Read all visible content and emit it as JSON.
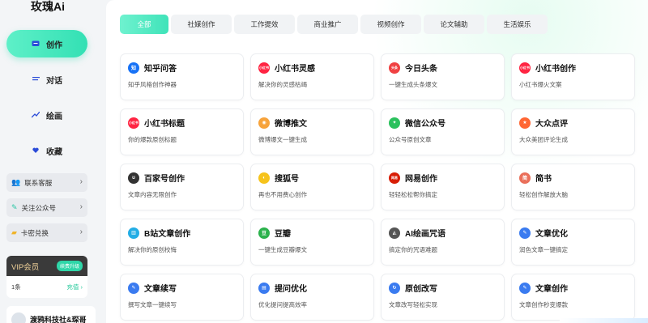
{
  "app": {
    "title": "玫瑰Ai"
  },
  "nav": [
    {
      "label": "创作",
      "icon": "chat-icon",
      "active": true
    },
    {
      "label": "对话",
      "icon": "chat-lines-icon",
      "active": false
    },
    {
      "label": "绘画",
      "icon": "brush-icon",
      "active": false
    },
    {
      "label": "收藏",
      "icon": "heart-icon",
      "active": false
    }
  ],
  "side_links": [
    {
      "label": "联系客服",
      "icon": "support-icon"
    },
    {
      "label": "关注公众号",
      "icon": "pin-icon"
    },
    {
      "label": "卡密兑换",
      "icon": "ticket-icon"
    }
  ],
  "vip": {
    "title": "VIP会员",
    "button": "续费升级",
    "count": "1条",
    "recharge": "充值 ›"
  },
  "company": {
    "name": "渡鸦科技社&琛哥"
  },
  "tabs": [
    "全部",
    "社媒创作",
    "工作提效",
    "商业推广",
    "视频创作",
    "论文辅助",
    "生活娱乐"
  ],
  "colors": {
    "accent": "#3fe3b9",
    "vip_gold": "#f2d39a"
  },
  "cards": [
    {
      "title": "知乎问答",
      "desc": "知乎风格创作神器",
      "icon": "zhihu-icon",
      "color": "#1772f6",
      "glyph": "知"
    },
    {
      "title": "小红书灵感",
      "desc": "解决你的灵感枯竭",
      "icon": "xiaohongshu-icon",
      "color": "#ff2442",
      "glyph": "小红书"
    },
    {
      "title": "今日头条",
      "desc": "一键生成头条爆文",
      "icon": "toutiao-icon",
      "color": "#f04142",
      "glyph": "头条"
    },
    {
      "title": "小红书创作",
      "desc": "小红书爆火文案",
      "icon": "xiaohongshu-icon",
      "color": "#ff2442",
      "glyph": "小红书"
    },
    {
      "title": "小红书标题",
      "desc": "你的爆款原创标题",
      "icon": "xiaohongshu-icon",
      "color": "#ff2442",
      "glyph": "小红书"
    },
    {
      "title": "微博推文",
      "desc": "微博爆文一键生成",
      "icon": "weibo-icon",
      "color": "#f7a33b",
      "glyph": "◉"
    },
    {
      "title": "微信公众号",
      "desc": "公众号原创文章",
      "icon": "wechat-icon",
      "color": "#2bc15d",
      "glyph": "✦"
    },
    {
      "title": "大众点评",
      "desc": "大众美团评论生成",
      "icon": "dianping-icon",
      "color": "#ff6633",
      "glyph": "★"
    },
    {
      "title": "百家号创作",
      "desc": "文章内容无限创作",
      "icon": "baijiahao-icon",
      "color": "#333333",
      "glyph": "ʊ"
    },
    {
      "title": "搜狐号",
      "desc": "再也不用费心创作",
      "icon": "sohu-icon",
      "color": "#f6c31c",
      "glyph": "◐"
    },
    {
      "title": "网易创作",
      "desc": "轻轻松松帮你搞定",
      "icon": "netease-icon",
      "color": "#d81e06",
      "glyph": "网易"
    },
    {
      "title": "简书",
      "desc": "轻松创作解放大脑",
      "icon": "jianshu-icon",
      "color": "#ea6f5a",
      "glyph": "简"
    },
    {
      "title": "B站文章创作",
      "desc": "解决你的原创校悔",
      "icon": "bilibili-icon",
      "color": "#23ade5",
      "glyph": "▥"
    },
    {
      "title": "豆瓣",
      "desc": "一键生成豆瓣爆文",
      "icon": "douban-icon",
      "color": "#2bb24c",
      "glyph": "豆"
    },
    {
      "title": "AI绘画咒语",
      "desc": "搞定你的咒语难题",
      "icon": "paint-icon",
      "color": "#555555",
      "glyph": "◭"
    },
    {
      "title": "文章优化",
      "desc": "润色文章一键搞定",
      "icon": "pen-icon",
      "color": "#3a7bf0",
      "glyph": "✎"
    },
    {
      "title": "文章续写",
      "desc": "撰写文章一键续写",
      "icon": "doc-pen-icon",
      "color": "#3a7bf0",
      "glyph": "✎"
    },
    {
      "title": "提问优化",
      "desc": "优化提问提高效率",
      "icon": "doc-icon",
      "color": "#3a7bf0",
      "glyph": "▤"
    },
    {
      "title": "原创改写",
      "desc": "文章改写轻松实现",
      "icon": "rewrite-icon",
      "color": "#3a7bf0",
      "glyph": "↻"
    },
    {
      "title": "文章创作",
      "desc": "文章创作秒变爆款",
      "icon": "doc-edit-icon",
      "color": "#3a7bf0",
      "glyph": "✎"
    }
  ]
}
